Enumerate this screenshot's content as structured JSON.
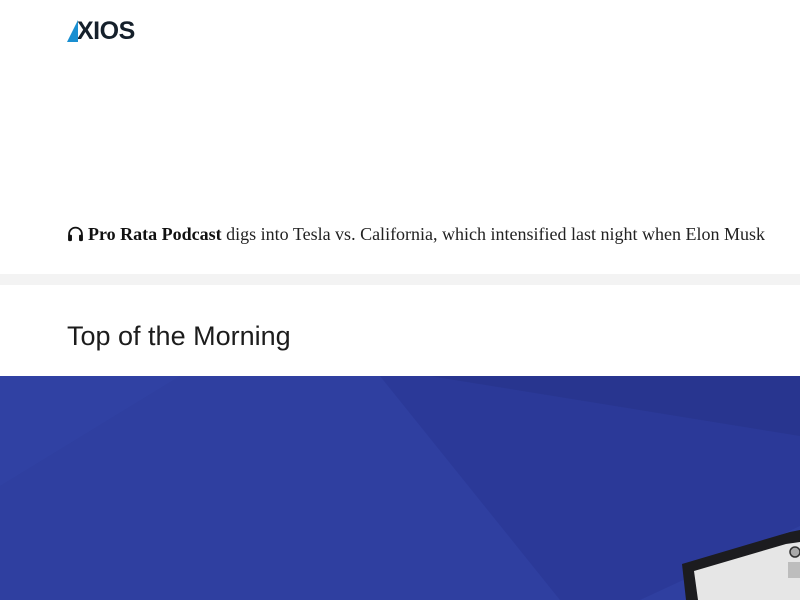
{
  "header": {
    "logo_text": "XIOS",
    "logo_alt": "AXIOS"
  },
  "podcast": {
    "icon": "headphones-icon",
    "name": "Pro Rata Podcast",
    "text": " digs into Tesla vs. California, which intensified last night when Elon Musk"
  },
  "section": {
    "heading": "Top of the Morning"
  },
  "colors": {
    "logo_accent": "#1a8fd1",
    "logo_text": "#15202b",
    "hero_background": "#2e3fa0",
    "divider": "#f3f3f3"
  }
}
